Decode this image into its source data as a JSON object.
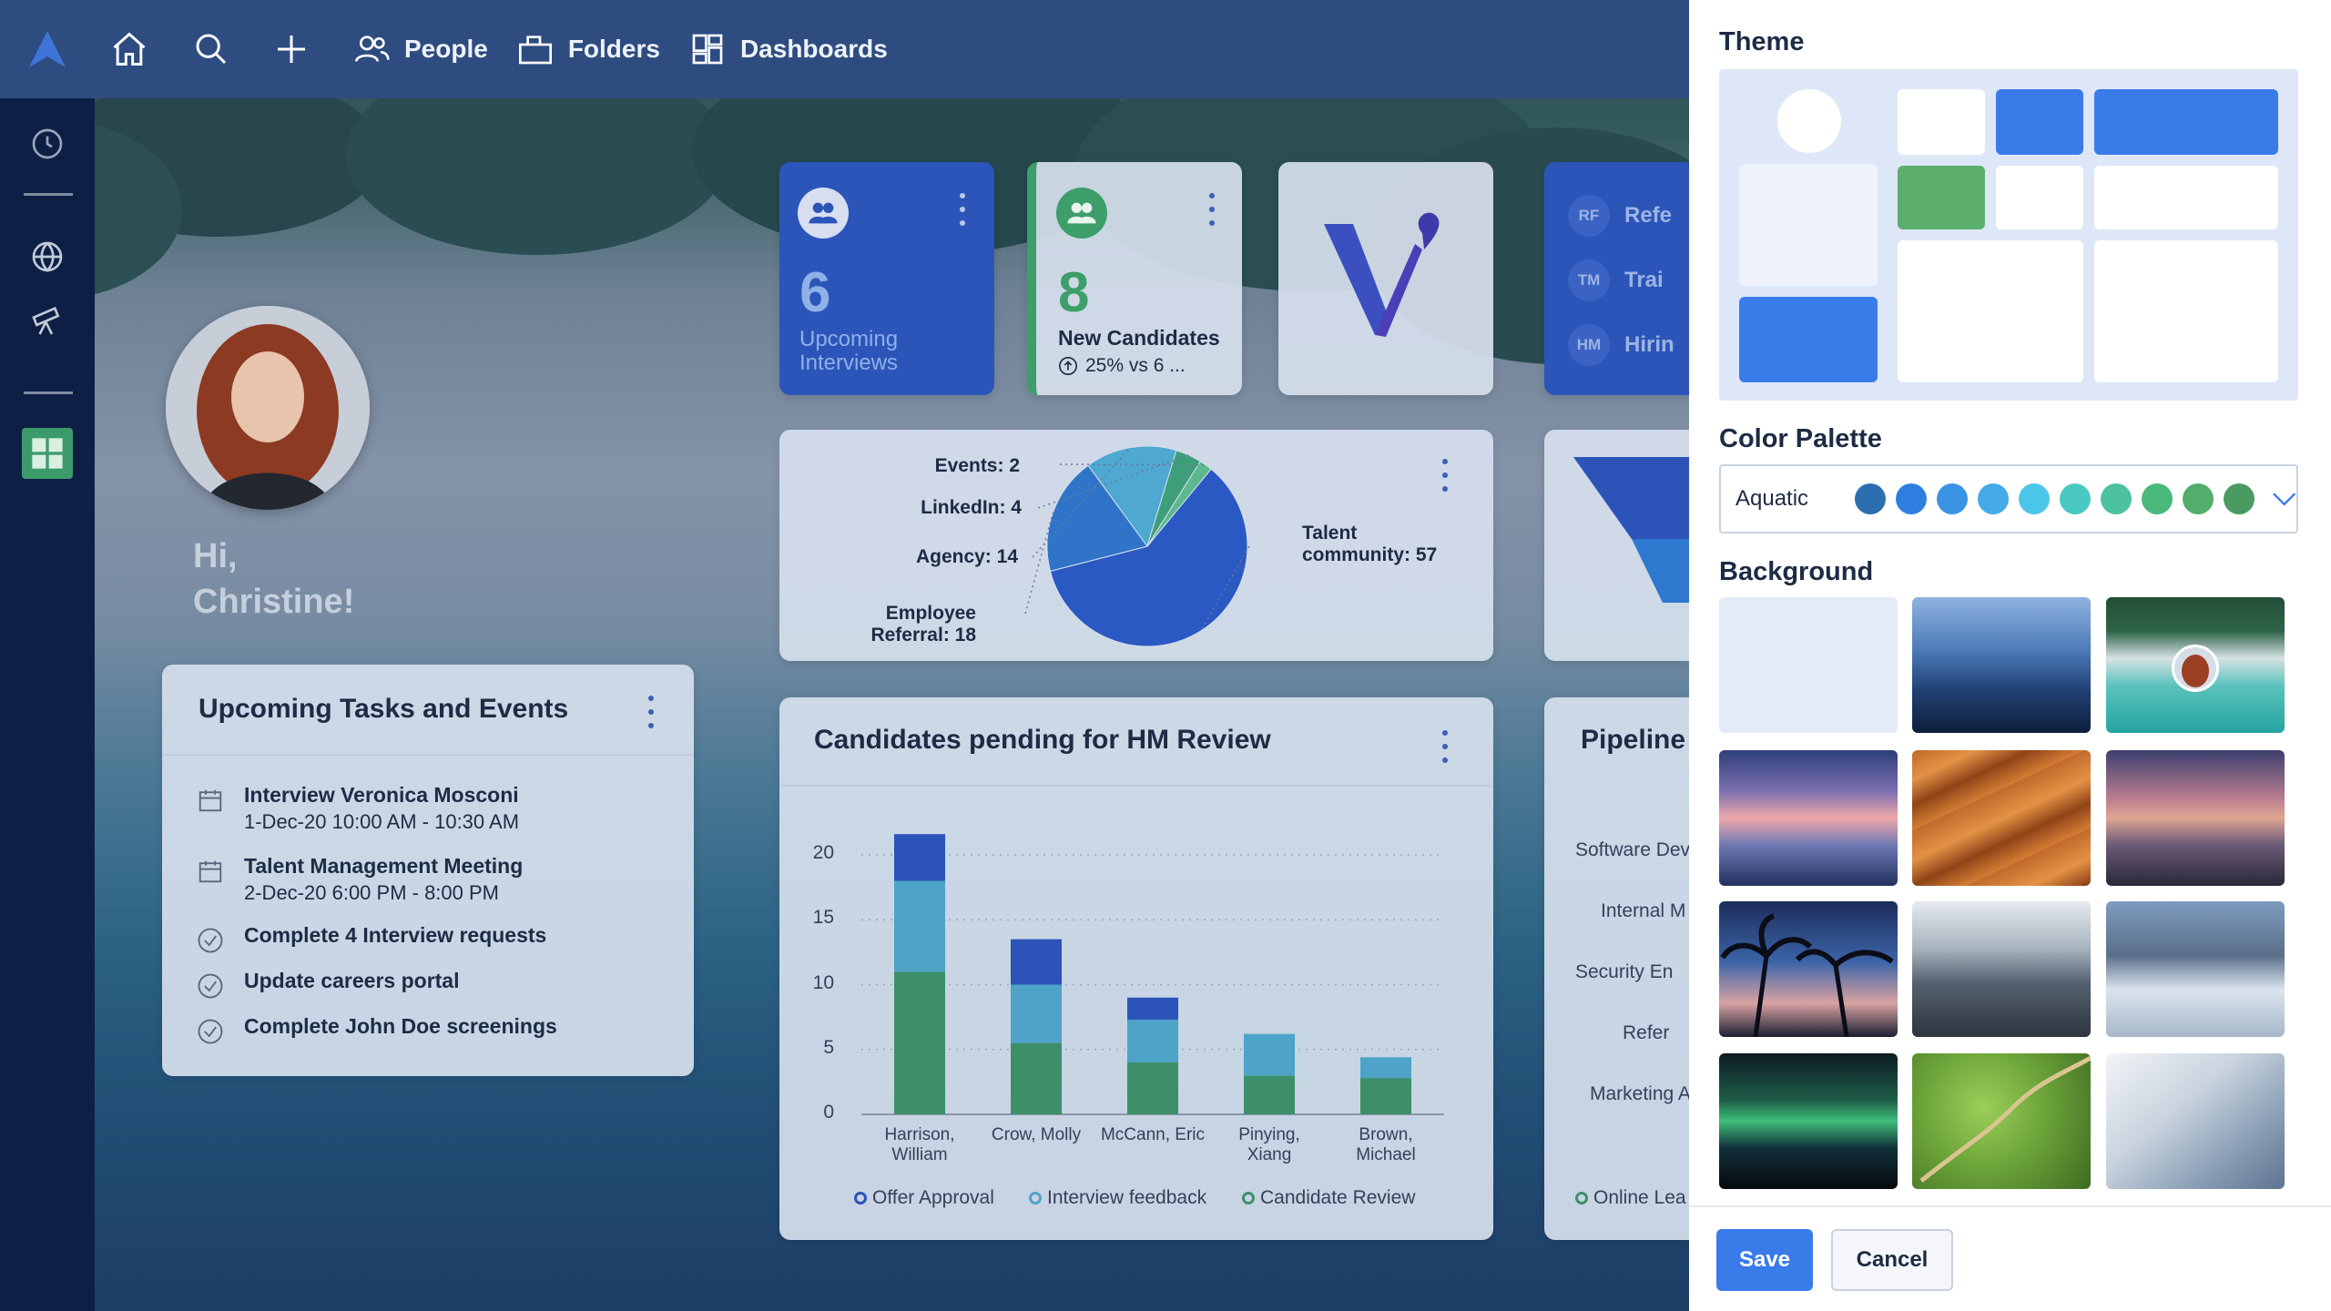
{
  "nav": {
    "people": "People",
    "folders": "Folders",
    "dashboards": "Dashboards"
  },
  "greeting": {
    "hi": "Hi,",
    "name": "Christine!"
  },
  "tasks": {
    "title": "Upcoming Tasks and Events",
    "items": [
      {
        "type": "calendar",
        "title": "Interview Veronica Mosconi",
        "time": "1-Dec-20 10:00 AM - 10:30 AM"
      },
      {
        "type": "calendar",
        "title": "Talent Management Meeting",
        "time": "2-Dec-20 6:00 PM - 8:00 PM"
      },
      {
        "type": "check",
        "title": "Complete 4 Interview requests"
      },
      {
        "type": "check",
        "title": "Update careers portal"
      },
      {
        "type": "check",
        "title": "Complete John Doe screenings"
      }
    ]
  },
  "kpi1": {
    "value": "6",
    "label": "Upcoming Interviews"
  },
  "kpi2": {
    "value": "8",
    "label": "New Candidates",
    "delta": "25% vs 6 ..."
  },
  "quicklinks": [
    {
      "abbr": "RF",
      "label": "Refe"
    },
    {
      "abbr": "TM",
      "label": "Trai"
    },
    {
      "abbr": "HM",
      "label": "Hirin"
    }
  ],
  "pie": {
    "slices": [
      {
        "label": "Talent community: 57",
        "value": 57,
        "color": "#2b59c3"
      },
      {
        "label": "Employee Referral: 18",
        "value": 18,
        "color": "#2f74c8"
      },
      {
        "label": "Agency: 14",
        "value": 14,
        "color": "#4ea8d2"
      },
      {
        "label": "LinkedIn: 4",
        "value": 4,
        "color": "#3e9e7a"
      },
      {
        "label": "Events: 2",
        "value": 2,
        "color": "#5cb88f"
      }
    ]
  },
  "chart_data": {
    "type": "bar",
    "title": "Candidates pending for HM Review",
    "categories": [
      "Harrison, William",
      "Crow, Molly",
      "McCann, Eric",
      "Pinying, Xiang",
      "Brown, Michael"
    ],
    "series": [
      {
        "name": "Candidate Review",
        "color": "#3d8f6a",
        "values": [
          11,
          5.5,
          4,
          3,
          2.8
        ]
      },
      {
        "name": "Interview feedback",
        "color": "#4ea3c9",
        "values": [
          7,
          4.5,
          3.3,
          3.2,
          1.6
        ]
      },
      {
        "name": "Offer Approval",
        "color": "#2b53b8",
        "values": [
          3.6,
          3.5,
          1.7,
          0,
          0
        ]
      }
    ],
    "yticks": [
      "0",
      "5",
      "10",
      "15",
      "20"
    ],
    "ylim": [
      0,
      20
    ]
  },
  "pipeline": {
    "title": "Pipeline",
    "rows": [
      "Software Dev",
      "Internal M",
      "Security En",
      "Refer",
      "Marketing A"
    ],
    "legend": "Online Lea"
  },
  "panel": {
    "theme_title": "Theme",
    "palette_title": "Color Palette",
    "palette_name": "Aquatic",
    "palette_colors": [
      "#2c6fb0",
      "#2f7fe0",
      "#3b93e6",
      "#44abe8",
      "#4cc6e8",
      "#49c9c2",
      "#4cc2a0",
      "#4ab87b",
      "#53ad6c",
      "#4a9a62"
    ],
    "background_title": "Background",
    "save": "Save",
    "cancel": "Cancel"
  }
}
